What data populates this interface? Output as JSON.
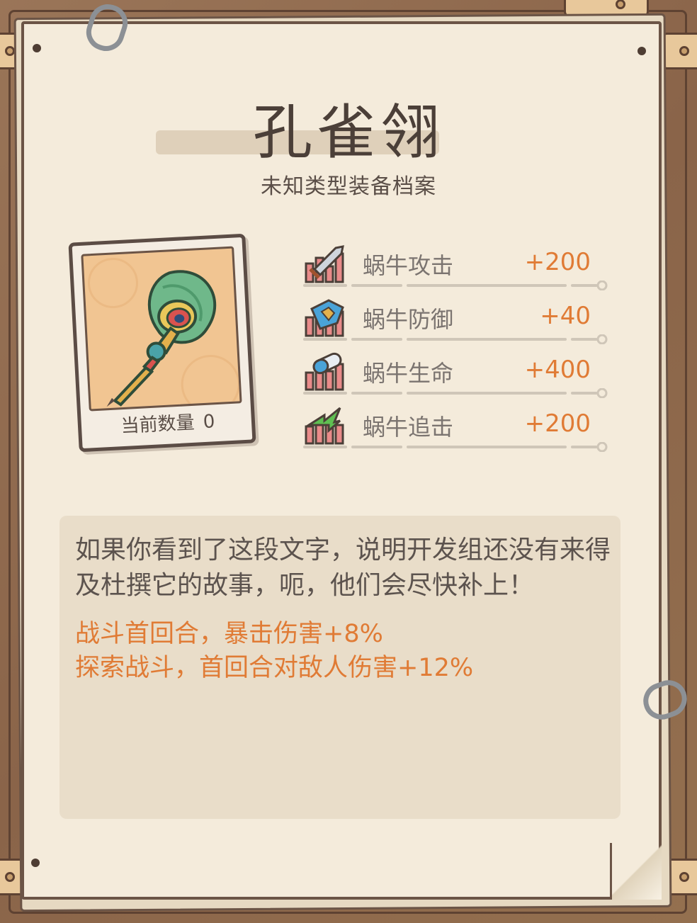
{
  "item": {
    "name": "孔雀翎",
    "subtitle": "未知类型装备档案",
    "count_label": "当前数量",
    "count_value": "0",
    "icon": "peacock-feather-staff-icon"
  },
  "stats": [
    {
      "label": "蜗牛攻击",
      "value": "+200",
      "icon": "sword-bar-icon",
      "color": "#d9534f"
    },
    {
      "label": "蜗牛防御",
      "value": "+40",
      "icon": "shield-bar-icon",
      "color": "#4aa3d8"
    },
    {
      "label": "蜗牛生命",
      "value": "+400",
      "icon": "pill-bar-icon",
      "color": "#4aa3d8"
    },
    {
      "label": "蜗牛追击",
      "value": "+200",
      "icon": "lightning-bar-icon",
      "color": "#5fbf52"
    }
  ],
  "description": {
    "text": "如果你看到了这段文字，说明开发组还没有来得及杜撰它的故事，呃，他们会尽快补上！",
    "effects": [
      "战斗首回合，暴击伤害+8%",
      "探索战斗，首回合对敌人伤害+12%"
    ]
  },
  "colors": {
    "accent": "#e07b35",
    "paper": "#f4ebdb",
    "frame": "#8d6a50",
    "text": "#4b3f38"
  }
}
